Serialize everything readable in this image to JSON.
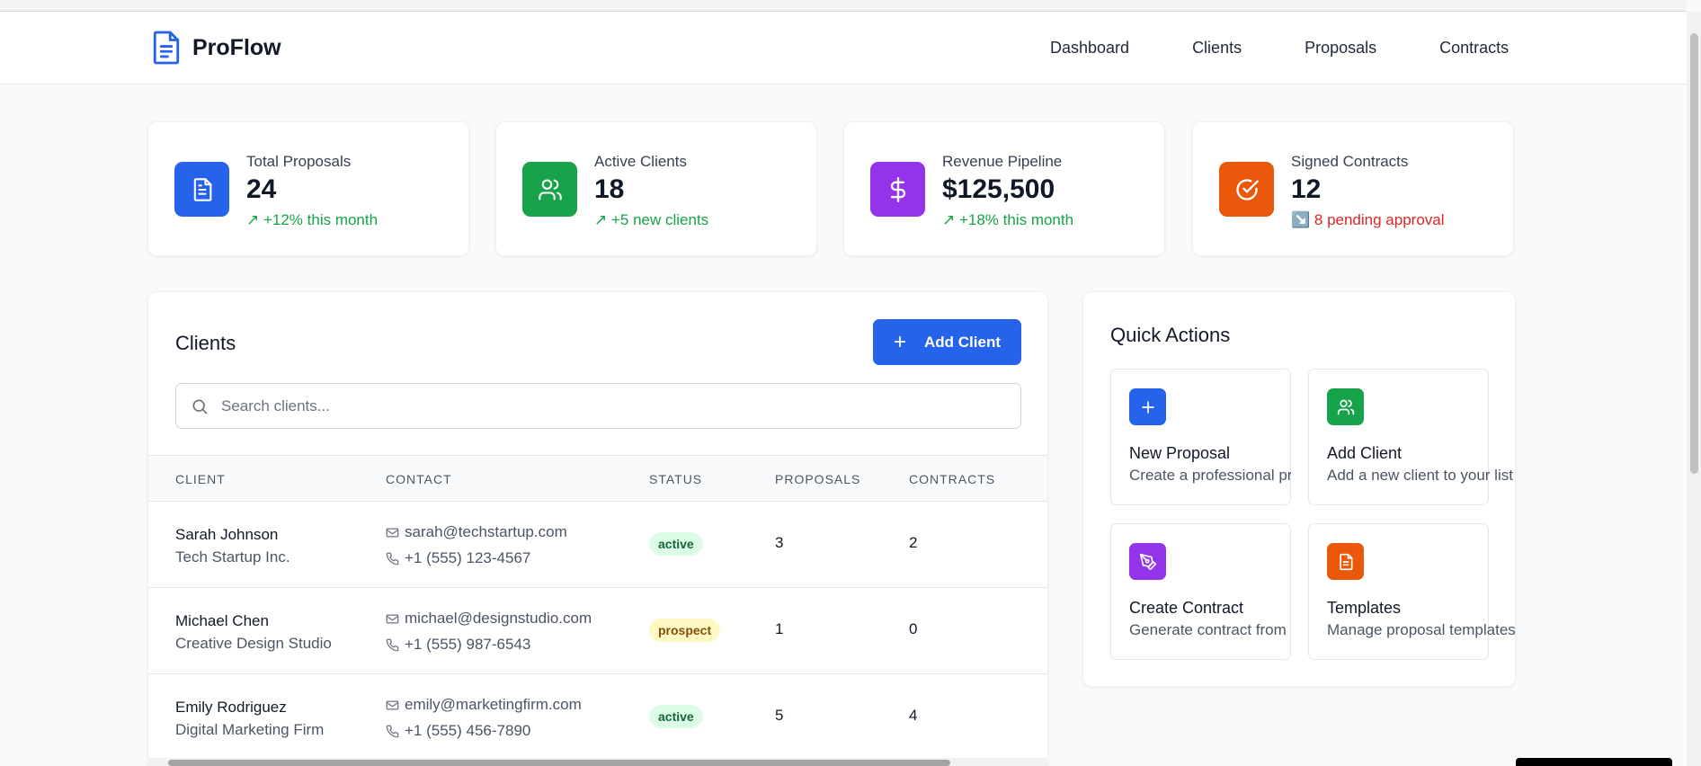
{
  "app": {
    "name": "ProFlow"
  },
  "nav": [
    {
      "label": "Dashboard"
    },
    {
      "label": "Clients"
    },
    {
      "label": "Proposals"
    },
    {
      "label": "Contracts"
    }
  ],
  "stats": [
    {
      "label": "Total Proposals",
      "value": "24",
      "change": "↗ +12% this month",
      "icon": "document-icon",
      "color": "#2563eb"
    },
    {
      "label": "Active Clients",
      "value": "18",
      "change": "↗ +5 new clients",
      "icon": "users-icon",
      "color": "#16a34a"
    },
    {
      "label": "Revenue Pipeline",
      "value": "$125,500",
      "change": "↗ +18% this month",
      "icon": "dollar-icon",
      "color": "#9333ea"
    },
    {
      "label": "Signed Contracts",
      "value": "12",
      "change": "↘️ 8 pending approval",
      "icon": "check-circle-icon",
      "color": "#ea580c"
    }
  ],
  "clients": {
    "title": "Clients",
    "add_button": "Add Client",
    "search_placeholder": "Search clients...",
    "columns": [
      "Client",
      "Contact",
      "Status",
      "Proposals",
      "Contracts"
    ],
    "rows": [
      {
        "name": "Sarah Johnson",
        "company": "Tech Startup Inc.",
        "email": "sarah@techstartup.com",
        "phone": "+1 (555) 123-4567",
        "status": "active",
        "proposals": "3",
        "contracts": "2"
      },
      {
        "name": "Michael Chen",
        "company": "Creative Design Studio",
        "email": "michael@designstudio.com",
        "phone": "+1 (555) 987-6543",
        "status": "prospect",
        "proposals": "1",
        "contracts": "0"
      },
      {
        "name": "Emily Rodriguez",
        "company": "Digital Marketing Firm",
        "email": "emily@marketingfirm.com",
        "phone": "+1 (555) 456-7890",
        "status": "active",
        "proposals": "5",
        "contracts": "4"
      }
    ]
  },
  "quick_actions": {
    "title": "Quick Actions",
    "items": [
      {
        "name": "New Proposal",
        "desc": "Create a professional pro",
        "icon": "plus-icon",
        "color": "#2563eb"
      },
      {
        "name": "Add Client",
        "desc": "Add a new client to your list",
        "icon": "users-icon",
        "color": "#16a34a"
      },
      {
        "name": "Create Contract",
        "desc": "Generate contract from p",
        "icon": "pen-icon",
        "color": "#9333ea"
      },
      {
        "name": "Templates",
        "desc": "Manage proposal templates",
        "icon": "document-icon",
        "color": "#ea580c"
      }
    ]
  }
}
